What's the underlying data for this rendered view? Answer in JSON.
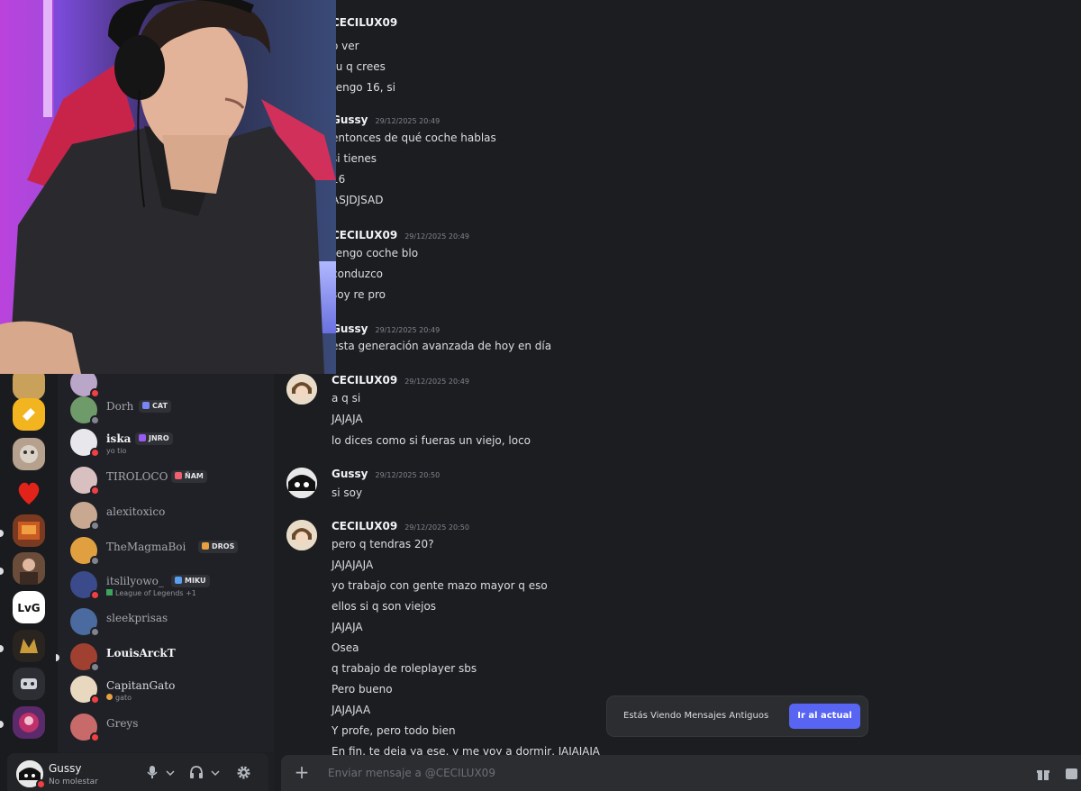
{
  "colors": {
    "background": "#1e1f22",
    "chat_bg": "#1c1d21",
    "accent": "#5865f2",
    "dnd": "#f23f43",
    "online": "#23a55a"
  },
  "members": [
    {
      "name": "",
      "sub": "",
      "tag": "",
      "status": "dnd"
    },
    {
      "name": "Dorh",
      "sub": "",
      "tag": "CAT",
      "status": "idle"
    },
    {
      "name": "iska",
      "sub": "yo tio",
      "tag": "JNRO",
      "status": "dnd"
    },
    {
      "name": "TIROLOCO",
      "sub": "",
      "tag": "ÑAM",
      "status": "dnd"
    },
    {
      "name": "alexitoxico",
      "sub": "",
      "tag": "",
      "status": "idle"
    },
    {
      "name": "TheMagmaBoi",
      "sub": "",
      "tag": "DROS",
      "status": "idle"
    },
    {
      "name": "itslilyowo_",
      "sub": "League of Legends +1",
      "tag": "MIKU",
      "status": "dnd"
    },
    {
      "name": "sleekprisas",
      "sub": "",
      "tag": "",
      "status": "idle"
    },
    {
      "name": "LouisArckT",
      "sub": "",
      "tag": "",
      "status": "idle"
    },
    {
      "name": "CapitanGato",
      "sub": "gato",
      "tag": "",
      "status": "dnd"
    },
    {
      "name": "Greys",
      "sub": "",
      "tag": "",
      "status": "dnd"
    }
  ],
  "user_panel": {
    "name": "Gussy",
    "status": "No molestar",
    "icons": [
      "microphone-icon",
      "chevron-down-icon",
      "headphones-icon",
      "chevron-down-icon",
      "gear-icon"
    ]
  },
  "messages": [
    {
      "author": "CECILUX09",
      "time": "",
      "lines": [
        "o ver",
        "tu q crees",
        "tengo 16, si"
      ],
      "show_avatar": false
    },
    {
      "author": "Gussy",
      "time": "29/12/2025 20:49",
      "lines": [
        "entonces de qué coche hablas",
        "si tienes",
        "16",
        "ASJDJSAD"
      ],
      "show_avatar": false
    },
    {
      "author": "CECILUX09",
      "time": "29/12/2025 20:49",
      "lines": [
        "tengo coche blo",
        "conduzco",
        "soy re pro"
      ],
      "show_avatar": false
    },
    {
      "author": "Gussy",
      "time": "29/12/2025 20:49",
      "lines": [
        "esta generación avanzada de hoy en día"
      ],
      "show_avatar": false
    },
    {
      "author": "CECILUX09",
      "time": "29/12/2025 20:49",
      "lines": [
        "a q si",
        "JAJAJA",
        "lo dices como si fueras un viejo, loco"
      ],
      "show_avatar": true
    },
    {
      "author": "Gussy",
      "time": "29/12/2025 20:50",
      "lines": [
        "si soy"
      ],
      "show_avatar": true
    },
    {
      "author": "CECILUX09",
      "time": "29/12/2025 20:50",
      "lines": [
        "pero q tendras 20?",
        "JAJAJAJA",
        "yo trabajo con gente mazo mayor q eso",
        "ellos si q son viejos",
        "JAJAJA",
        "Osea",
        "q trabajo de roleplayer sbs",
        "Pero bueno",
        "JAJAJAA",
        "Y profe, pero todo bien",
        "En fin, te deja ya ese, y me voy a dormir, JAJAJAJA"
      ],
      "show_avatar": true
    }
  ],
  "jump_banner": {
    "text": "Estás Viendo Mensajes Antiguos",
    "button": "Ir al actual"
  },
  "composer": {
    "placeholder": "Enviar mensaje a @CECILUX09"
  }
}
